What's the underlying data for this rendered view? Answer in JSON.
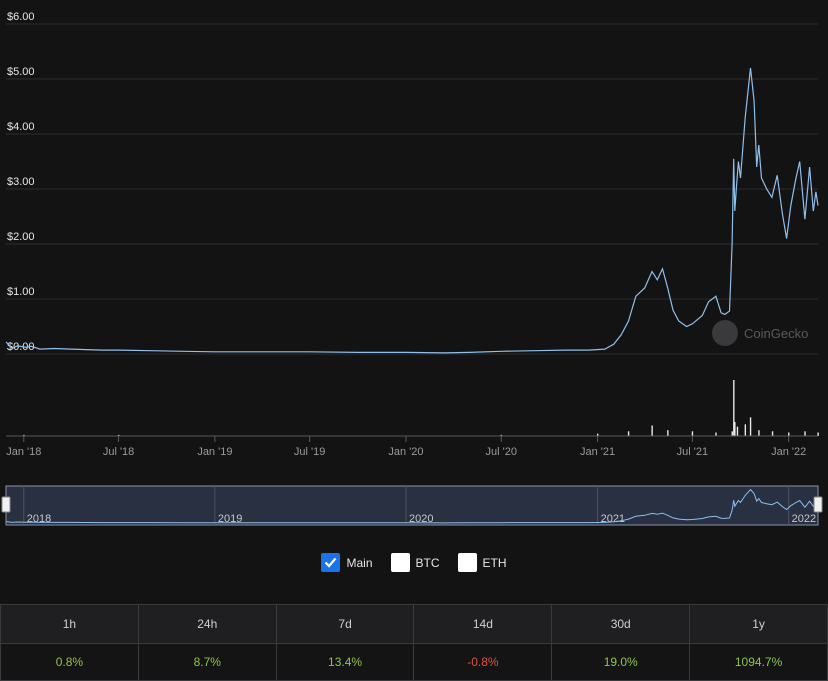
{
  "chart_data": {
    "type": "line",
    "watermark": "CoinGecko",
    "y_axis": {
      "ticks": [
        "$0.00",
        "$1.00",
        "$2.00",
        "$3.00",
        "$4.00",
        "$5.00",
        "$6.00"
      ],
      "range": [
        0,
        6
      ]
    },
    "x_axis": {
      "ticks": [
        "Jan '18",
        "Jul '18",
        "Jan '19",
        "Jul '19",
        "Jan '20",
        "Jul '20",
        "Jan '21",
        "Jul '21",
        "Jan '22"
      ],
      "tick_dates": [
        "2018-01-01",
        "2018-07-01",
        "2019-01-01",
        "2019-07-01",
        "2020-01-01",
        "2020-07-01",
        "2021-01-01",
        "2021-07-01",
        "2022-01-01"
      ],
      "range": [
        "2017-11-28",
        "2022-02-26"
      ]
    },
    "grid": true,
    "series": [
      {
        "color": "#8fbfeb",
        "x": [
          "2017-11-28",
          "2017-12-10",
          "2017-12-20",
          "2018-01-05",
          "2018-01-15",
          "2018-02-01",
          "2018-03-01",
          "2018-04-01",
          "2018-05-01",
          "2018-06-01",
          "2018-07-01",
          "2018-09-01",
          "2018-11-01",
          "2019-01-01",
          "2019-04-01",
          "2019-07-01",
          "2019-10-01",
          "2020-01-01",
          "2020-03-15",
          "2020-05-01",
          "2020-07-01",
          "2020-09-01",
          "2020-11-01",
          "2020-12-15",
          "2021-01-15",
          "2021-02-01",
          "2021-02-15",
          "2021-03-01",
          "2021-03-15",
          "2021-04-01",
          "2021-04-15",
          "2021-04-25",
          "2021-05-05",
          "2021-05-15",
          "2021-05-25",
          "2021-06-05",
          "2021-06-20",
          "2021-07-01",
          "2021-07-20",
          "2021-08-01",
          "2021-08-15",
          "2021-08-25",
          "2021-09-01",
          "2021-09-10",
          "2021-09-15",
          "2021-09-18",
          "2021-09-20",
          "2021-09-23",
          "2021-09-27",
          "2021-10-01",
          "2021-10-10",
          "2021-10-20",
          "2021-10-27",
          "2021-11-01",
          "2021-11-05",
          "2021-11-10",
          "2021-11-15",
          "2021-11-20",
          "2021-11-30",
          "2021-12-10",
          "2021-12-20",
          "2021-12-28",
          "2022-01-05",
          "2022-01-15",
          "2022-01-22",
          "2022-02-01",
          "2022-02-10",
          "2022-02-17",
          "2022-02-22",
          "2022-02-26"
        ],
        "values": [
          0.22,
          0.1,
          0.15,
          0.12,
          0.14,
          0.09,
          0.1,
          0.09,
          0.08,
          0.07,
          0.07,
          0.06,
          0.05,
          0.04,
          0.04,
          0.04,
          0.03,
          0.03,
          0.02,
          0.03,
          0.05,
          0.06,
          0.07,
          0.07,
          0.09,
          0.18,
          0.35,
          0.6,
          1.05,
          1.2,
          1.5,
          1.35,
          1.55,
          1.2,
          0.8,
          0.6,
          0.5,
          0.55,
          0.7,
          0.95,
          1.05,
          0.75,
          0.72,
          0.78,
          2.0,
          3.55,
          2.6,
          3.0,
          3.5,
          3.2,
          4.3,
          5.2,
          4.6,
          3.4,
          3.8,
          3.2,
          3.1,
          3.0,
          2.85,
          3.25,
          2.55,
          2.1,
          2.7,
          3.2,
          3.5,
          2.45,
          3.4,
          2.6,
          2.95,
          2.7
        ]
      }
    ],
    "volume": {
      "x": [
        "2018-01-01",
        "2018-07-01",
        "2019-01-01",
        "2019-07-01",
        "2020-01-01",
        "2020-07-01",
        "2021-01-01",
        "2021-03-01",
        "2021-04-15",
        "2021-05-15",
        "2021-07-01",
        "2021-08-15",
        "2021-09-15",
        "2021-09-18",
        "2021-09-20",
        "2021-09-25",
        "2021-10-10",
        "2021-10-20",
        "2021-11-05",
        "2021-12-01",
        "2022-01-01",
        "2022-02-01",
        "2022-02-26"
      ],
      "values": [
        1,
        1,
        0,
        0,
        0,
        1,
        2,
        4,
        9,
        5,
        4,
        3,
        4,
        48,
        12,
        8,
        10,
        16,
        5,
        4,
        3,
        4,
        3
      ]
    },
    "navigator": {
      "labels": [
        "2018",
        "2019",
        "2020",
        "2021",
        "2022"
      ],
      "label_dates": [
        "2018-01-01",
        "2019-01-01",
        "2020-01-01",
        "2021-01-01",
        "2022-01-01"
      ]
    }
  },
  "series_toggles": [
    {
      "label": "Main",
      "checked": true
    },
    {
      "label": "BTC",
      "checked": false
    },
    {
      "label": "ETH",
      "checked": false
    }
  ],
  "performance": {
    "headers": [
      "1h",
      "24h",
      "7d",
      "14d",
      "30d",
      "1y"
    ],
    "values": [
      "0.8%",
      "8.7%",
      "13.4%",
      "-0.8%",
      "19.0%",
      "1094.7%"
    ],
    "signs": [
      "pos",
      "pos",
      "pos",
      "neg",
      "pos",
      "pos"
    ]
  },
  "colors": {
    "background": "#131314",
    "line": "#8fbfeb",
    "grid": "#2e2e30",
    "positive": "#8dc647",
    "negative": "#e15241",
    "checkbox_checked": "#1a73e8"
  }
}
